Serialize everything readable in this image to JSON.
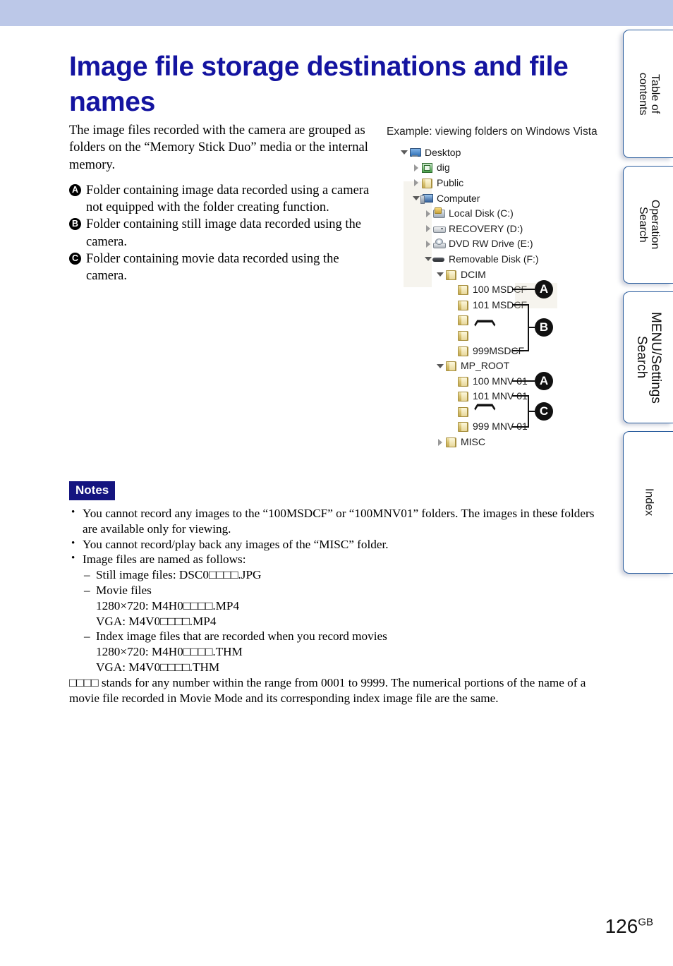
{
  "header": {
    "band_color": "#bcc8e8"
  },
  "title": "Image file storage destinations and file names",
  "intro": "The image files recorded with the camera are grouped as folders on the “Memory Stick Duo” media or the internal memory.",
  "abc_items": [
    {
      "badge": "A",
      "text": "Folder containing image data recorded using a camera not equipped with the folder creating function."
    },
    {
      "badge": "B",
      "text": "Folder containing still image data recorded using the camera."
    },
    {
      "badge": "C",
      "text": "Folder containing movie data recorded using the camera."
    }
  ],
  "tree": {
    "caption": "Example: viewing folders on Windows Vista",
    "nodes": [
      {
        "label": "Desktop",
        "indent": 0,
        "toggle": "open",
        "icon": "monitor-icon"
      },
      {
        "label": "dig",
        "indent": 1,
        "toggle": "closed",
        "icon": "green-folder-icon"
      },
      {
        "label": "Public",
        "indent": 1,
        "toggle": "closed",
        "icon": "folder-icon"
      },
      {
        "label": "Computer",
        "indent": 1,
        "toggle": "open",
        "icon": "computer-icon"
      },
      {
        "label": "Local Disk (C:)",
        "indent": 2,
        "toggle": "closed",
        "icon": "local-disk-icon"
      },
      {
        "label": "RECOVERY (D:)",
        "indent": 2,
        "toggle": "closed",
        "icon": "drive-icon"
      },
      {
        "label": "DVD RW Drive (E:)",
        "indent": 2,
        "toggle": "closed",
        "icon": "dvd-drive-icon"
      },
      {
        "label": "Removable Disk (F:)",
        "indent": 2,
        "toggle": "open",
        "icon": "removable-disk-icon"
      },
      {
        "label": "DCIM",
        "indent": 3,
        "toggle": "open",
        "icon": "folder-icon"
      },
      {
        "label": "100 MSDCF",
        "indent": 4,
        "toggle": "none",
        "icon": "folder-icon"
      },
      {
        "label": "101 MSDCF",
        "indent": 4,
        "toggle": "none",
        "icon": "folder-icon"
      },
      {
        "label": "",
        "indent": 4,
        "toggle": "none",
        "icon": "folder-icon"
      },
      {
        "label": "",
        "indent": 4,
        "toggle": "none",
        "icon": "folder-icon"
      },
      {
        "label": "999MSDCF",
        "indent": 4,
        "toggle": "none",
        "icon": "folder-icon"
      },
      {
        "label": "MP_ROOT",
        "indent": 3,
        "toggle": "open",
        "icon": "folder-icon"
      },
      {
        "label": "100 MNV 01",
        "indent": 4,
        "toggle": "none",
        "icon": "folder-icon"
      },
      {
        "label": "101 MNV 01",
        "indent": 4,
        "toggle": "none",
        "icon": "folder-icon"
      },
      {
        "label": "",
        "indent": 4,
        "toggle": "none",
        "icon": "folder-icon"
      },
      {
        "label": "999 MNV 01",
        "indent": 4,
        "toggle": "none",
        "icon": "folder-icon"
      },
      {
        "label": "MISC",
        "indent": 3,
        "toggle": "closed",
        "icon": "folder-icon"
      }
    ],
    "callouts": [
      {
        "letter": "A",
        "target": "100 MSDCF"
      },
      {
        "letter": "B",
        "target": "101 MSDCF – 999MSDCF"
      },
      {
        "letter": "A",
        "target": "100 MNV 01"
      },
      {
        "letter": "C",
        "target": "101 MNV 01 – 999 MNV 01"
      }
    ],
    "range_glyph": "❴"
  },
  "notes": {
    "label": "Notes",
    "items": [
      {
        "kind": "bullet",
        "text": "You cannot record any images to the “100MSDCF” or “100MNV01” folders. The images in these folders are available only for viewing."
      },
      {
        "kind": "bullet",
        "text": "You cannot record/play back any images of the “MISC” folder."
      },
      {
        "kind": "bullet",
        "text": "Image files are named as follows:"
      },
      {
        "kind": "dash",
        "text": "Still image files: DSC0□□□□.JPG"
      },
      {
        "kind": "dash",
        "text": "Movie files"
      },
      {
        "kind": "sub",
        "text": "1280×720: M4H0□□□□.MP4"
      },
      {
        "kind": "sub",
        "text": "VGA: M4V0□□□□.MP4"
      },
      {
        "kind": "dash",
        "text": "Index image files that are recorded when you record movies"
      },
      {
        "kind": "sub",
        "text": "1280×720: M4H0□□□□.THM"
      },
      {
        "kind": "sub",
        "text": "VGA: M4V0□□□□.THM"
      },
      {
        "kind": "plain",
        "text": "□□□□ stands for any number within the range from 0001 to 9999. The numerical portions of the name of a movie file recorded in Movie Mode and its corresponding index image file are the same."
      }
    ]
  },
  "tabs": [
    {
      "id": "table-of-contents",
      "label": "Table of\ncontents"
    },
    {
      "id": "operation-search",
      "label": "Operation\nSearch"
    },
    {
      "id": "menu-settings-search",
      "label": "MENU/Settings\nSearch"
    },
    {
      "id": "index",
      "label": "Index"
    }
  ],
  "footer": {
    "page_number": "126",
    "page_suffix": "GB"
  }
}
